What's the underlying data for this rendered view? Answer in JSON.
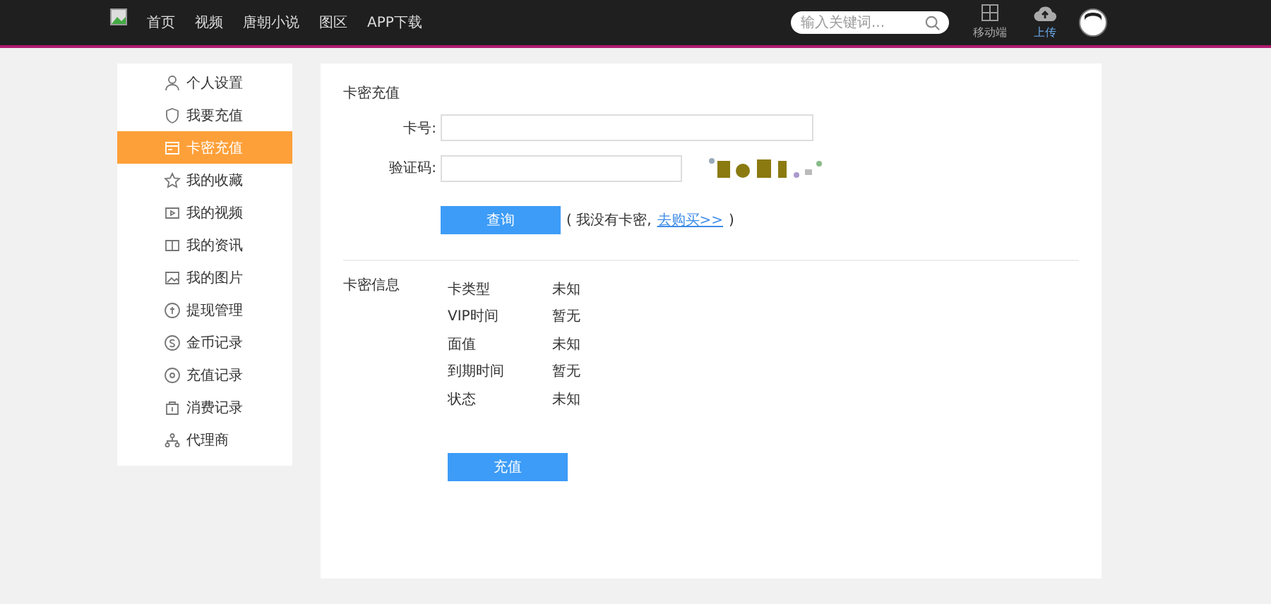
{
  "header": {
    "nav": [
      {
        "label": "首页"
      },
      {
        "label": "视频"
      },
      {
        "label": "唐朝小说"
      },
      {
        "label": "图区"
      },
      {
        "label": "APP下载"
      }
    ],
    "search": {
      "placeholder": "输入关键词..."
    },
    "actions": [
      {
        "kind": "app",
        "label": "移动端"
      },
      {
        "kind": "upload",
        "label": "上传"
      }
    ]
  },
  "sidebar": {
    "items": [
      {
        "label": "个人设置",
        "selected": false
      },
      {
        "label": "我要充值",
        "selected": false
      },
      {
        "label": "卡密充值",
        "selected": true
      },
      {
        "label": "我的收藏",
        "selected": false
      },
      {
        "label": "我的视频",
        "selected": false
      },
      {
        "label": "我的资讯",
        "selected": false
      },
      {
        "label": "我的图片",
        "selected": false
      },
      {
        "label": "提现管理",
        "selected": false
      },
      {
        "label": "金币记录",
        "selected": false
      },
      {
        "label": "充值记录",
        "selected": false
      },
      {
        "label": "消费记录",
        "selected": false
      },
      {
        "label": "代理商",
        "selected": false
      }
    ]
  },
  "recharge": {
    "title": "卡密充值",
    "card_label": "卡号:",
    "captcha_label": "验证码:",
    "query_button": "查询",
    "hint_prefix": "( 我没有卡密,",
    "buy_link": "去购买>>",
    "hint_suffix": ")"
  },
  "info": {
    "title": "卡密信息",
    "rows": [
      {
        "label": "卡类型",
        "value": "未知"
      },
      {
        "label": "VIP时间",
        "value": "暂无"
      },
      {
        "label": "面值",
        "value": "未知"
      },
      {
        "label": "到期时间",
        "value": "暂无"
      },
      {
        "label": "状态",
        "value": "未知"
      }
    ],
    "submit_button": "充值"
  }
}
